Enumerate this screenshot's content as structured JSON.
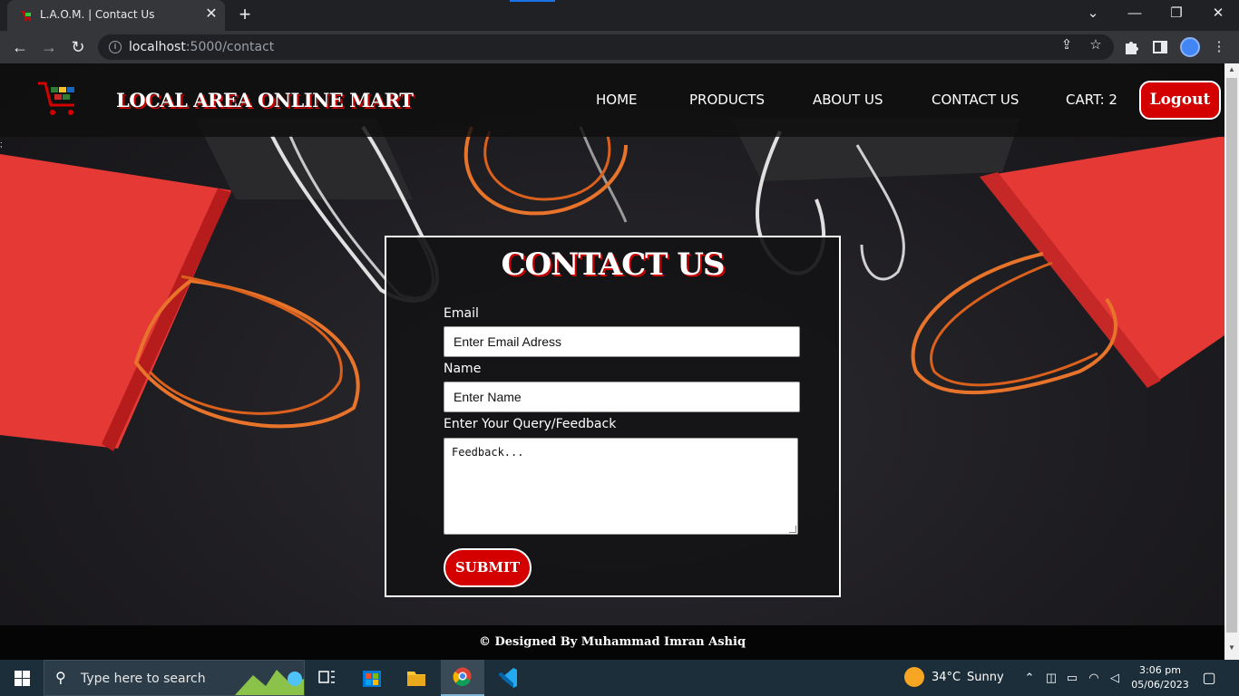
{
  "browser": {
    "tab_title": "L.A.O.M. | Contact Us",
    "tab_close": "✕",
    "new_tab": "+",
    "url_host": "localhost",
    "url_path": ":5000/contact",
    "window_controls": [
      "⌄",
      "—",
      "❐",
      "✕"
    ]
  },
  "header": {
    "brand": "LOCAL AREA ONLINE MART",
    "nav": [
      "HOME",
      "PRODUCTS",
      "ABOUT US",
      "CONTACT US",
      "CART: 2"
    ],
    "logout": "Logout"
  },
  "stray_text": ";",
  "contact": {
    "title": "CONTACT US",
    "email_label": "Email",
    "email_placeholder": "Enter Email Adress",
    "name_label": "Name",
    "name_placeholder": "Enter Name",
    "query_label": "Enter Your Query/Feedback",
    "query_placeholder": "Feedback...",
    "submit": "SUBMIT"
  },
  "footer": {
    "text": "© Designed By Muhammad Imran Ashiq"
  },
  "taskbar": {
    "search_placeholder": "Type here to search",
    "weather_temp": "34°C",
    "weather_desc": "Sunny",
    "time": "3:06 pm",
    "date": "05/06/2023"
  },
  "colors": {
    "accent_red": "#d40000",
    "header_bg": "#0f0f0f",
    "bag_red": "#e53935",
    "handle_orange": "#e8742c"
  }
}
